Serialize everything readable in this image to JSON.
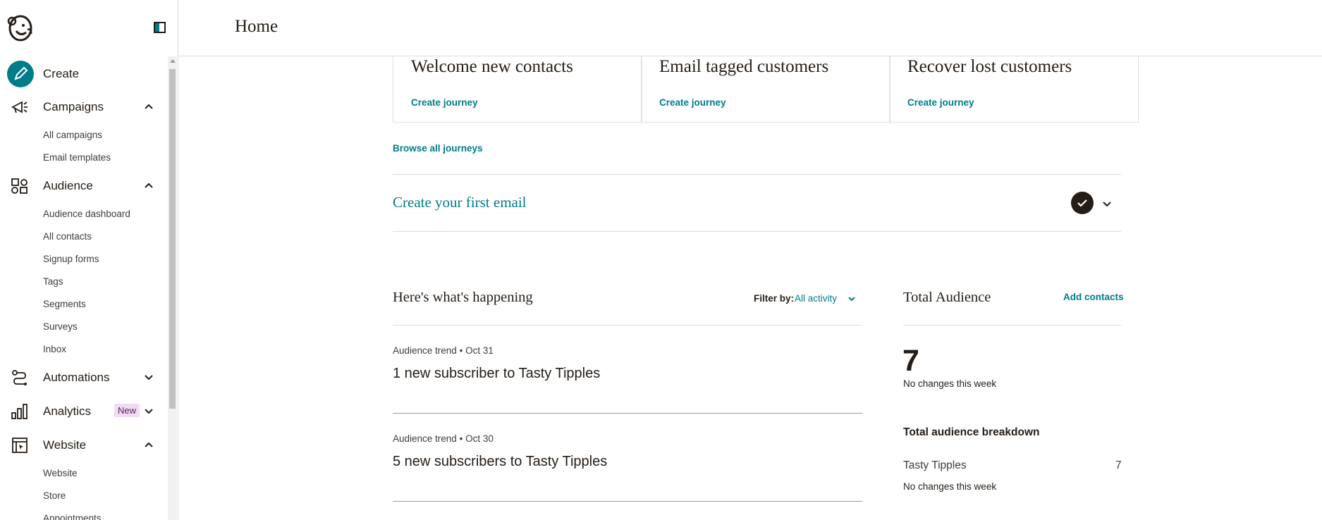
{
  "header": {
    "title": "Home"
  },
  "sidebar": {
    "create_label": "Create",
    "campaigns": {
      "label": "Campaigns",
      "items": [
        "All campaigns",
        "Email templates"
      ]
    },
    "audience": {
      "label": "Audience",
      "items": [
        "Audience dashboard",
        "All contacts",
        "Signup forms",
        "Tags",
        "Segments",
        "Surveys",
        "Inbox"
      ]
    },
    "automations": {
      "label": "Automations"
    },
    "analytics": {
      "label": "Analytics",
      "badge": "New"
    },
    "website": {
      "label": "Website",
      "items": [
        "Website",
        "Store",
        "Appointments"
      ]
    }
  },
  "journeys": {
    "cards": [
      {
        "title": "Welcome new contacts",
        "link": "Create journey"
      },
      {
        "title": "Email tagged customers",
        "link": "Create journey"
      },
      {
        "title": "Recover lost customers",
        "link": "Create journey"
      }
    ],
    "browse_label": "Browse all journeys"
  },
  "first_email": {
    "label": "Create your first email"
  },
  "activity": {
    "title": "Here's what's happening",
    "filter_label": "Filter by:",
    "filter_value": "All activity",
    "items": [
      {
        "type": "Audience trend",
        "date": "• Oct 31",
        "text": "1 new subscriber to Tasty Tipples"
      },
      {
        "type": "Audience trend",
        "date": "• Oct 30",
        "text": "5 new subscribers to Tasty Tipples"
      }
    ]
  },
  "audience_panel": {
    "title": "Total Audience",
    "add_label": "Add contacts",
    "count": "7",
    "change": "No changes this week",
    "breakdown_title": "Total audience breakdown",
    "breakdown": [
      {
        "name": "Tasty Tipples",
        "count": "7",
        "change": "No changes this week"
      }
    ]
  },
  "colors": {
    "accent": "#007c89",
    "text": "#241c15",
    "badge_bg": "#f1dbf3"
  }
}
